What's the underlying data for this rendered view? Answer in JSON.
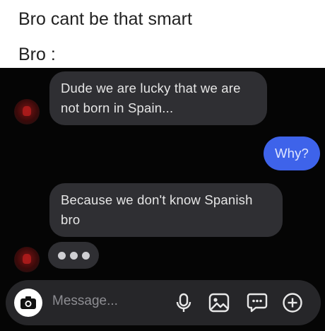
{
  "caption": {
    "line1": "Bro cant be that smart",
    "line2": "Bro :"
  },
  "messages": [
    {
      "from": "them",
      "text_line1": "Dude we are lucky that we are",
      "text_line2": "not born in Spain..."
    },
    {
      "from": "me",
      "text": "Why?"
    },
    {
      "from": "them",
      "text_line1": "Because we don't know Spanish",
      "text_line2": "bro"
    }
  ],
  "composer": {
    "placeholder": "Message...",
    "icons": [
      "camera-icon",
      "microphone-icon",
      "gallery-icon",
      "sticker-icon",
      "plus-icon"
    ]
  },
  "colors": {
    "sent_bubble": "#3e63ea",
    "received_bubble": "#2f2f33",
    "background": "#050505"
  }
}
